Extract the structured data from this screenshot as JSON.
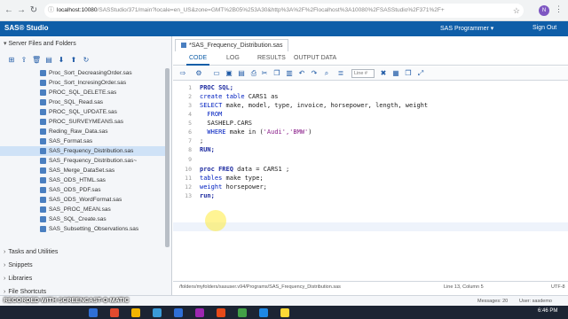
{
  "browser": {
    "url_host": "localhost:10080",
    "url_rest": "/SASStudio/371/main?locale=en_US&zone=GMT%2B05%253A30&http%3A%2F%2Flocalhost%3A10080%2FSASStudio%2F371%2F+",
    "avatar_letter": "N"
  },
  "header": {
    "title": "SAS® Studio",
    "user": "SAS Programmer ▾",
    "signout": "Sign Out"
  },
  "left_panel": {
    "section_title": "Server Files and Folders",
    "files": [
      {
        "name": "Proc_Sort_DecreasingOrder.sas"
      },
      {
        "name": "Proc_Sort_IncresingOrder.sas"
      },
      {
        "name": "PROC_SQL_DELETE.sas"
      },
      {
        "name": "Proc_SQL_Read.sas"
      },
      {
        "name": "PROC_SQL_UPDATE.sas"
      },
      {
        "name": "PROC_SURVEYMEANS.sas"
      },
      {
        "name": "Reding_Raw_Data.sas"
      },
      {
        "name": "SAS_Format.sas"
      },
      {
        "name": "SAS_Frequency_Distribution.sas"
      },
      {
        "name": "SAS_Frequency_Distribution.sas~"
      },
      {
        "name": "SAS_Merge_DataSet.sas"
      },
      {
        "name": "SAS_ODS_HTML.sas"
      },
      {
        "name": "SAS_ODS_PDF.sas"
      },
      {
        "name": "SAS_ODS_WordFormat.sas"
      },
      {
        "name": "SAS_PROC_MEAN.sas"
      },
      {
        "name": "SAS_SQL_Create.sas"
      },
      {
        "name": "SAS_Subsetting_Observations.sas"
      }
    ],
    "selected_index": 8,
    "sections": [
      "Tasks and Utilities",
      "Snippets",
      "Libraries",
      "File Shortcuts"
    ]
  },
  "editor": {
    "file_tab": "*SAS_Frequency_Distribution.sas",
    "tabs": [
      "CODE",
      "LOG",
      "RESULTS",
      "OUTPUT DATA"
    ],
    "active_tab": "CODE",
    "line_placeholder": "Line #",
    "line_numbers": [
      "1",
      "2",
      "3",
      "4",
      "5",
      "6",
      "7",
      "8",
      "9",
      "10",
      "11",
      "12",
      "13"
    ],
    "code": {
      "l1": "PROC SQL;",
      "l2a": "create table",
      "l2b": " CARS1 as",
      "l3a": "SELECT",
      "l3b": " make, model, type, invoice, horsepower, length, weight",
      "l4": "  FROM",
      "l5": "  SASHELP.CARS",
      "l6a": "  WHERE",
      "l6b": " make in (",
      "l6c": "'Audi','BMW'",
      "l6d": ")",
      "l7": ";",
      "l8": "RUN;",
      "l10a": "proc FREQ",
      "l10b": " data = ",
      "l10c": "CARS1 ;",
      "l11a": "tables",
      "l11b": " make type;",
      "l12a": "weight",
      "l12b": " horsepower;",
      "l13": "run;"
    },
    "status_path": "/folders/myfolders/sasuser.v94/Programs/SAS_Frequency_Distribution.sas",
    "status_pos": "Line 13, Column 5",
    "status_enc": "UTF-8"
  },
  "bottom": {
    "messages": "Messages: 20",
    "user": "User: sasdemo"
  },
  "watermark": "RECORDED WITH SCREENCAST-O-MATIC",
  "taskbar": {
    "time": "6:46 PM"
  },
  "colors": {
    "sas_blue": "#0f5ea8",
    "selected_row": "#cfe2f7"
  }
}
